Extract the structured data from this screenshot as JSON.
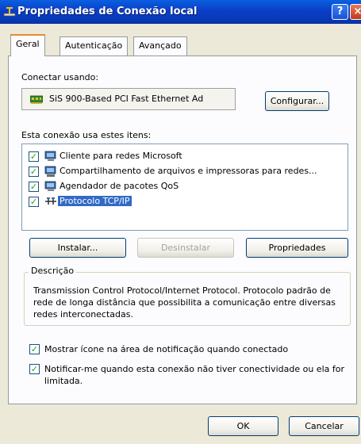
{
  "window": {
    "title": "Propriedades de Conexão local",
    "help_label": "?",
    "close_label": "×"
  },
  "tabs": [
    {
      "label": "Geral",
      "active": true
    },
    {
      "label": "Autenticação",
      "active": false
    },
    {
      "label": "Avançado",
      "active": false
    }
  ],
  "connect_using": {
    "label": "Conectar usando:",
    "device_name": "SiS 900-Based PCI Fast Ethernet Ad",
    "configure_button": "Configurar..."
  },
  "components": {
    "label": "Esta conexão usa estes itens:",
    "items": [
      {
        "label": "Cliente para redes Microsoft",
        "checked": true,
        "icon": "network-client-icon",
        "selected": false
      },
      {
        "label": "Compartilhamento de arquivos e impressoras para redes...",
        "checked": true,
        "icon": "file-printer-sharing-icon",
        "selected": false
      },
      {
        "label": "Agendador de pacotes QoS",
        "checked": true,
        "icon": "qos-scheduler-icon",
        "selected": false
      },
      {
        "label": "Protocolo TCP/IP",
        "checked": true,
        "icon": "protocol-icon",
        "selected": true
      }
    ]
  },
  "actions": {
    "install": "Instalar...",
    "uninstall": "Desinstalar",
    "properties": "Propriedades"
  },
  "description": {
    "legend": "Descrição",
    "text": "Transmission Control Protocol/Internet Protocol. Protocolo padrão de rede de longa distância que possibilita a comunicação entre diversas redes interconectadas."
  },
  "options": [
    {
      "label": "Mostrar ícone na área de notificação quando conectado",
      "checked": true
    },
    {
      "label": "Notificar-me quando esta conexão não tiver conectividade ou ela for limitada.",
      "checked": true
    }
  ],
  "footer": {
    "ok": "OK",
    "cancel": "Cancelar"
  },
  "colors": {
    "titlebar": "#0a3fc8",
    "dialog_bg": "#ece9d8",
    "selection": "#316ac5",
    "check": "#21a121"
  }
}
